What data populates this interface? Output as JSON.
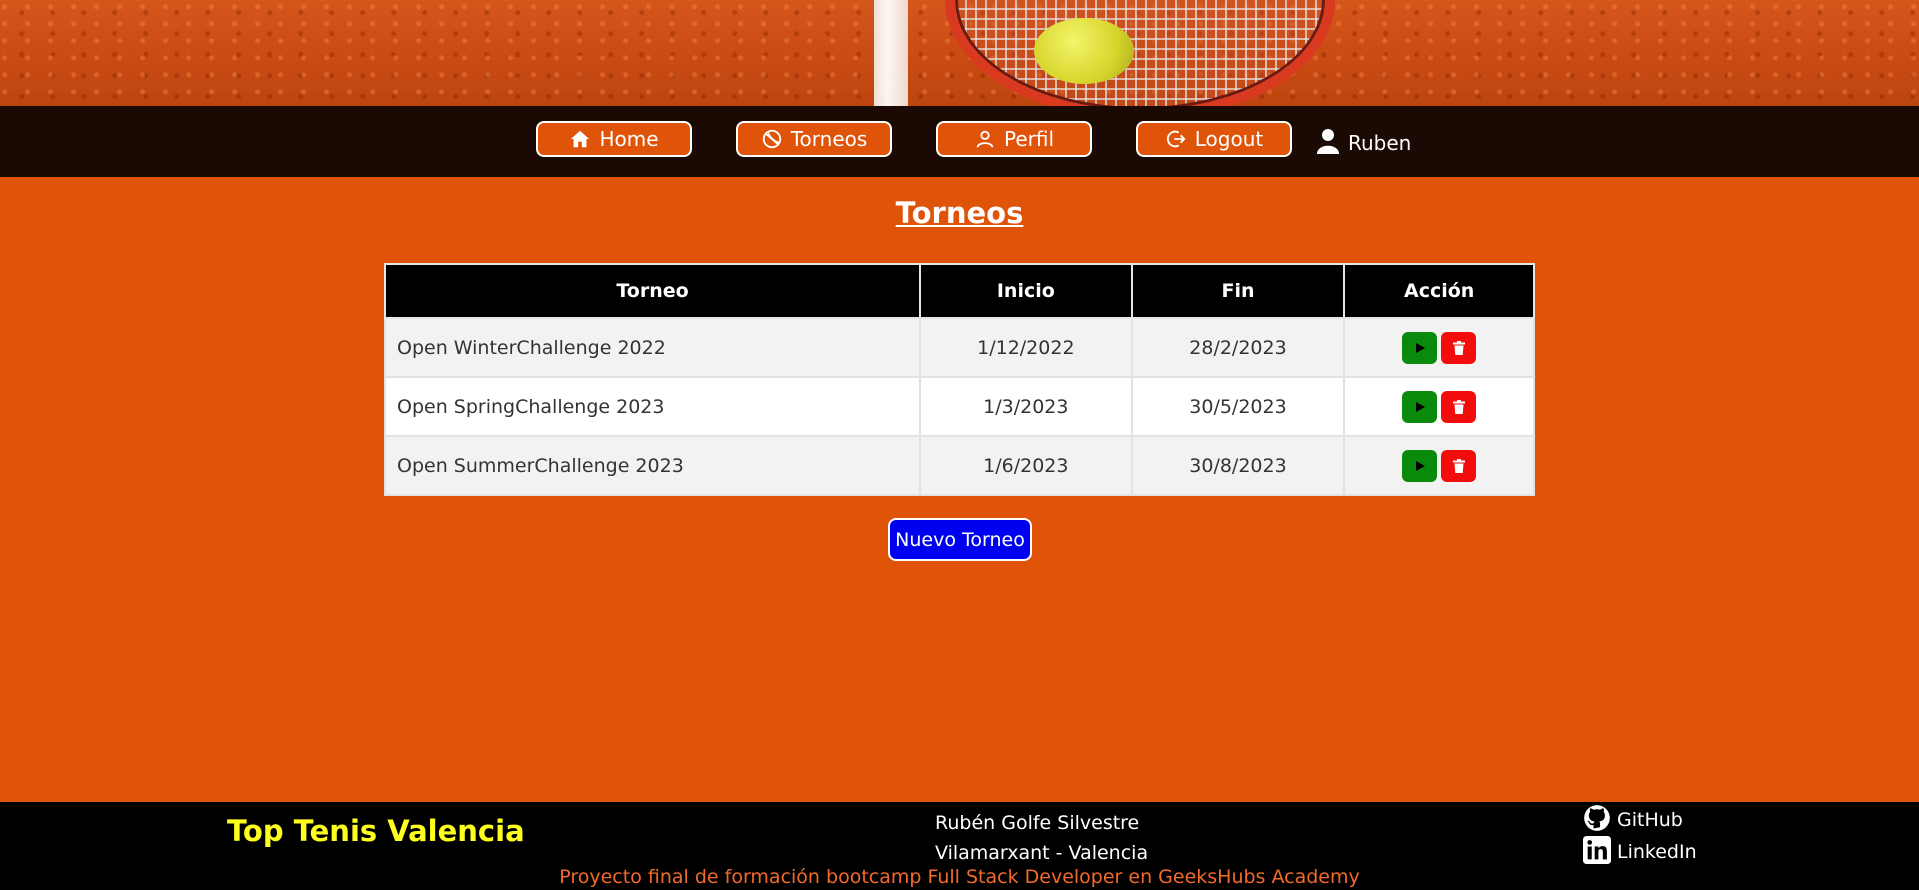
{
  "nav": {
    "items": [
      {
        "label": "Home",
        "icon": "home-icon"
      },
      {
        "label": "Torneos",
        "icon": "tennis-ball-icon"
      },
      {
        "label": "Perfil",
        "icon": "user-outline-icon"
      },
      {
        "label": "Logout",
        "icon": "logout-icon"
      }
    ],
    "user": "Ruben"
  },
  "page": {
    "title": "Torneos"
  },
  "table": {
    "headers": [
      "Torneo",
      "Inicio",
      "Fin",
      "Acción"
    ],
    "rows": [
      {
        "torneo": "Open WinterChallenge 2022",
        "inicio": "1/12/2022",
        "fin": "28/2/2023"
      },
      {
        "torneo": "Open SpringChallenge 2023",
        "inicio": "1/3/2023",
        "fin": "30/5/2023"
      },
      {
        "torneo": "Open SummerChallenge 2023",
        "inicio": "1/6/2023",
        "fin": "30/8/2023"
      }
    ],
    "actions": {
      "play_icon": "play-icon",
      "delete_icon": "trash-icon"
    }
  },
  "new_button": "Nuevo Torneo",
  "footer": {
    "brand": "Top Tenis Valencia",
    "author_name": "Rubén Golfe Silvestre",
    "author_location": "Vilamarxant - Valencia",
    "links": [
      {
        "label": "GitHub",
        "icon": "github-icon"
      },
      {
        "label": "LinkedIn",
        "icon": "linkedin-icon"
      }
    ],
    "credit": "Proyecto final de formación bootcamp Full Stack Developer en GeeksHubs Academy"
  },
  "colors": {
    "background": "#e0540a",
    "nav_bg": "#1b0903",
    "brand": "#ffff1e",
    "play": "#0a8a0a",
    "delete": "#f20c0c",
    "new_button": "#0000f0"
  }
}
